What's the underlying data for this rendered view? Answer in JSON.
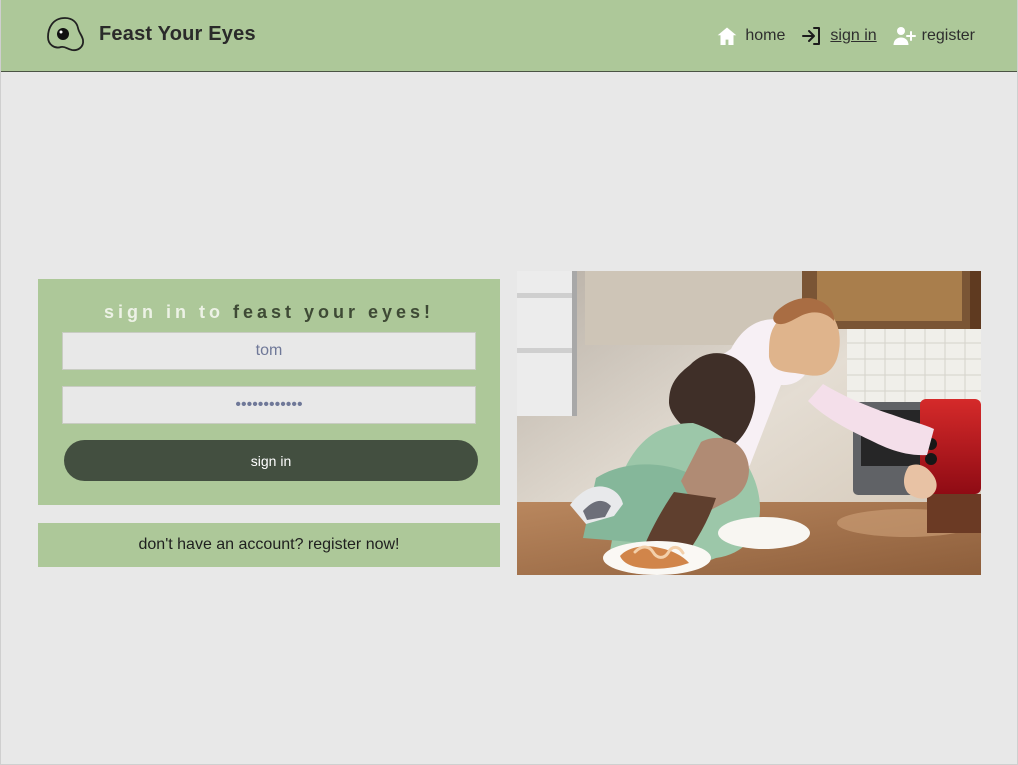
{
  "brand": {
    "name": "Feast Your Eyes",
    "icon": "fried-egg-icon"
  },
  "nav": {
    "items": [
      {
        "label": "home",
        "icon": "home-icon",
        "active": false
      },
      {
        "label": "sign in",
        "icon": "sign-in-icon",
        "active": true
      },
      {
        "label": "register",
        "icon": "add-user-icon",
        "active": false
      }
    ]
  },
  "signin": {
    "title_prefix": "sign in to",
    "title_brand": "feast your eyes!",
    "username_value": "tom",
    "password_value": "••••••••••••",
    "submit_label": "sign in"
  },
  "register_prompt": "don't have an account? register now!",
  "hero": {
    "image": "two-men-looking-into-toaster-oven-photo"
  },
  "colors": {
    "accent": "#adc899",
    "button": "#434f40",
    "background": "#e8e8e8"
  }
}
